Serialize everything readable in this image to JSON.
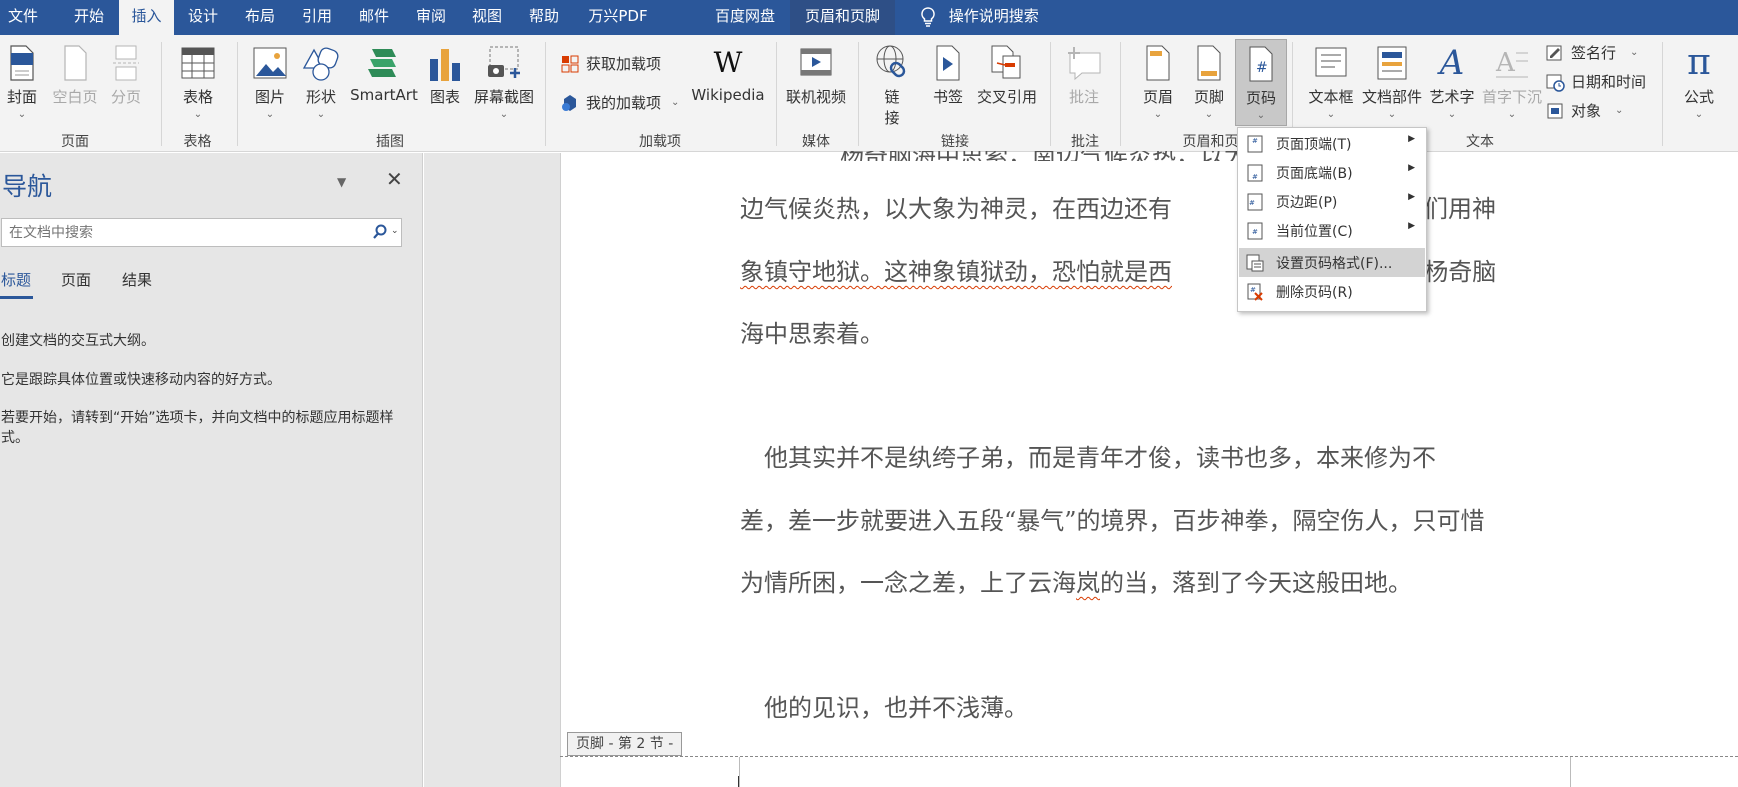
{
  "tabs": [
    "文件",
    "开始",
    "插入",
    "设计",
    "布局",
    "引用",
    "邮件",
    "审阅",
    "视图",
    "帮助",
    "万兴PDF",
    "百度网盘",
    "页眉和页脚"
  ],
  "search_label": "操作说明搜索",
  "ribbon": {
    "cover": "封面",
    "blank_page": "空白页",
    "page_break": "分页",
    "table": "表格",
    "picture": "图片",
    "shapes": "形状",
    "smartart": "SmartArt",
    "chart": "图表",
    "screenshot": "屏幕截图",
    "get_addins": "获取加载项",
    "my_addins": "我的加载项",
    "wikipedia_logo": "W",
    "wikipedia": "Wikipedia",
    "online_video": "联机视频",
    "link_1": "链",
    "link_2": "接",
    "bookmark": "书签",
    "cross_ref": "交叉引用",
    "comment": "批注",
    "header": "页眉",
    "footer": "页脚",
    "page_number": "页码",
    "textbox": "文本框",
    "quick_parts": "文档部件",
    "wordart": "艺术字",
    "dropcap": "首字下沉",
    "signature": "签名行",
    "datetime": "日期和时间",
    "object": "对象",
    "equation": "公式",
    "pi": "π"
  },
  "groups": {
    "pages": "页面",
    "tables": "表格",
    "illustrations": "插图",
    "addins": "加载项",
    "media": "媒体",
    "links": "链接",
    "comments": "批注",
    "header_footer": "页眉和页脚",
    "text": "文本"
  },
  "nav": {
    "title": "导航",
    "search_placeholder": "在文档中搜索",
    "tabs": [
      "标题",
      "页面",
      "结果"
    ],
    "hint1": "创建文档的交互式大纲。",
    "hint2": "它是跟踪具体位置或快速移动内容的好方式。",
    "hint3": "若要开始，请转到“开始”选项卡，并向文档中的标题应用标题样式。"
  },
  "doc": {
    "top_partial": "杨奇脑海中思索，南边气候炎热，以大象为神灵",
    "p1": [
      "边气候炎热，以大象为神灵，在西边还有",
      "是人们用神"
    ],
    "p2": [
      "象镇守地狱。这神象镇狱劲，恐怕就是西",
      "法。”杨奇脑"
    ],
    "p3": "海中思索着。",
    "p4": "他其实并不是纨绔子弟，而是青年才俊，读书也多，本来修为不",
    "p5": "差，差一步就要进入五段“暴气”的境界，百步神拳，隔空伤人，只可惜",
    "p6a": "为情所困，一念之差，上了云海",
    "p6b": "岚",
    "p6c": "的当，落到了今天这般田地。",
    "p7": "他的见识，也并不浅薄。",
    "footer_label": "页脚 - 第 2 节 -"
  },
  "menu": [
    {
      "label": "页面顶端(T)"
    },
    {
      "label": "页面底端(B)"
    },
    {
      "label": "页边距(P)"
    },
    {
      "label": "当前位置(C)"
    },
    {
      "label": "设置页码格式(F)..."
    },
    {
      "label": "删除页码(R)"
    }
  ],
  "colors": {
    "accent": "#2b579a",
    "ribbon_bg": "#f3f3f3",
    "nav_bg": "#e6e6e6"
  }
}
